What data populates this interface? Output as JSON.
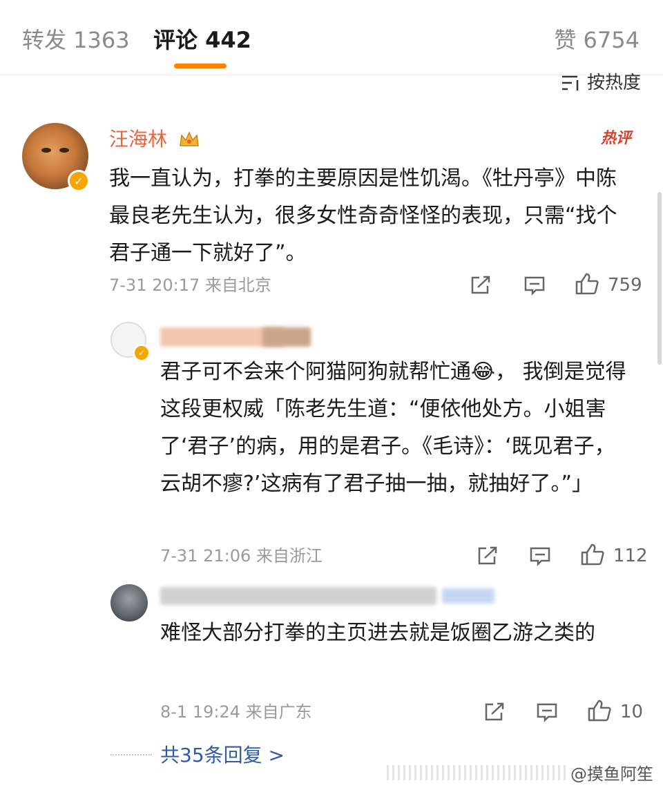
{
  "tabs": {
    "repost": "转发 1363",
    "comments": "评论 442",
    "likes": "赞 6754"
  },
  "sort_label": "按热度",
  "comments": [
    {
      "user": "汪海林",
      "hot_badge": "热评",
      "text": "我一直认为，打拳的主要原因是性饥渴。《牡丹亭》中陈最良老先生认为，很多女性奇奇怪怪的表现，只需“找个君子通一下就好了”。",
      "time": "7-31 20:17",
      "location": "来自北京",
      "likes": "759"
    },
    {
      "user": "",
      "text": "君子可不会来个阿猫阿狗就帮忙通😂， 我倒是觉得这段更权威「陈老先生道：“便依他处方。小姐害了‘君子’的病，用的是君子。《毛诗》：‘既见君子，云胡不瘳?’这病有了君子抽一抽，就抽好了。”」",
      "time": "7-31 21:06",
      "location": "来自浙江",
      "likes": "112"
    },
    {
      "user": "",
      "text": "难怪大部分打拳的主页进去就是饭圈乙游之类的",
      "time": "8-1 19:24",
      "location": "来自广东",
      "likes": "10"
    }
  ],
  "more_replies": "共35条回复 >",
  "watermark": "@摸鱼阿笙",
  "colors": {
    "accent": "#ff8200",
    "username": "#e8643a",
    "hot_badge": "#d9412b",
    "link": "#2f5aa8",
    "meta": "#9a9a9a",
    "verified": "#f7a500"
  }
}
